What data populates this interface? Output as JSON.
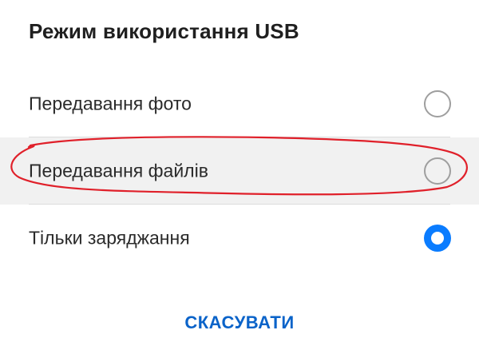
{
  "dialog": {
    "title": "Режим використання USB",
    "options": [
      {
        "label": "Передавання фото",
        "selected": false
      },
      {
        "label": "Передавання файлів",
        "selected": false
      },
      {
        "label": "Тільки заряджання",
        "selected": true
      }
    ],
    "cancel_label": "СКАСУВАТИ"
  },
  "colors": {
    "accent": "#0a7cff",
    "cancel_text": "#0a63c9",
    "pressed_row": "#f1f1f1",
    "annotation": "#e0202a"
  }
}
